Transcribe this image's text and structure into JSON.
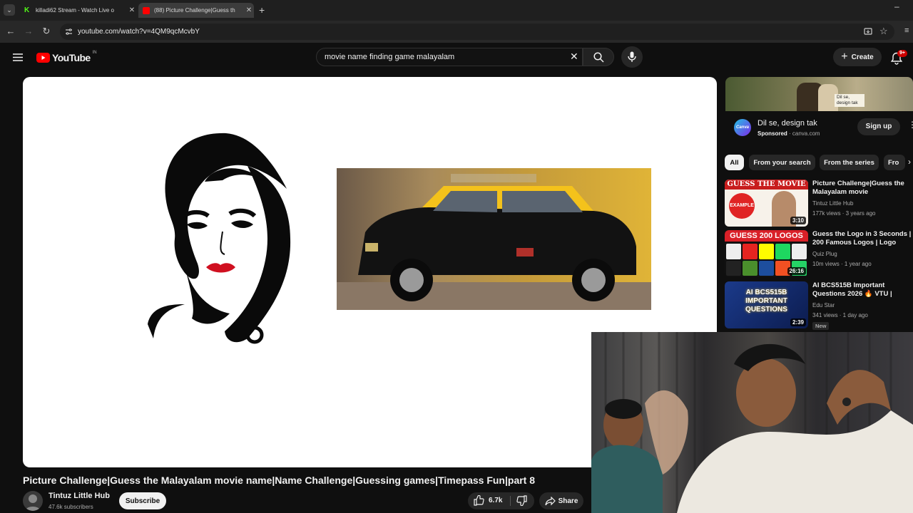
{
  "browser": {
    "tabs": [
      {
        "title": "killadi62 Stream - Watch Live o",
        "favicon_color": "#53fc18"
      },
      {
        "title": "(88) Picture Challenge|Guess th",
        "favicon_color": "#ff0000"
      }
    ],
    "url": "youtube.com/watch?v=4QM9qcMcvbY"
  },
  "youtube": {
    "logo_text": "YouTube",
    "country_code": "IN",
    "search_value": "movie name finding game malayalam",
    "create_label": "Create",
    "notification_count": "9+"
  },
  "video": {
    "title": "Picture Challenge|Guess the Malayalam movie name|Name Challenge|Guessing games|Timepass Fun|part 8",
    "channel_name": "Tintuz Little Hub",
    "subscribers": "47.6k subscribers",
    "subscribe_label": "Subscribe",
    "likes": "6.7k",
    "share_label": "Share"
  },
  "ad": {
    "title": "Dil se, design tak",
    "sponsored": "Sponsored",
    "domain": "canva.com",
    "cta": "Sign up",
    "brand": "Canva",
    "image_text": "Dil se, design tak"
  },
  "chips": [
    "All",
    "From your search",
    "From the series",
    "Fro"
  ],
  "recommendations": [
    {
      "title": "Picture Challenge|Guess the Malayalam movie name|Name...",
      "channel": "Tintuz Little Hub",
      "meta": "177k views · 3 years ago",
      "duration": "3:10",
      "thumb_text": "GUESS THE MOVIE",
      "thumb_badge": "EXAMPLE"
    },
    {
      "title": "Guess the Logo in 3 Seconds | 200 Famous Logos | Logo Qui...",
      "channel": "Quiz Plug",
      "meta": "10m views · 1 year ago",
      "duration": "26:16",
      "thumb_text": "GUESS 200 LOGOS"
    },
    {
      "title": "AI BCS515B Important Questions 2026 🔥 VTU | Scor...",
      "channel": "Edu Star",
      "meta": "341 views · 1 day ago",
      "duration": "2:39",
      "badge": "New",
      "thumb_text": "AI BCS515B IMPORTANT QUESTIONS"
    }
  ],
  "colors": {
    "background": "#0f0f0f",
    "youtube_red": "#ff0000",
    "pill": "#272727",
    "taxi_yellow": "#f4c21b"
  }
}
